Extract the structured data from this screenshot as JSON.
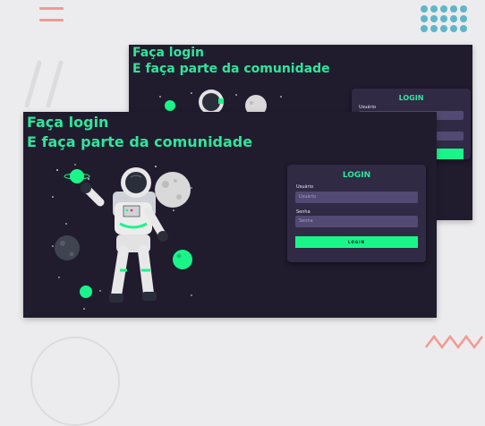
{
  "front_screen": {
    "heading_line1": "Faça login",
    "heading_line2": "E faça parte da comunidade",
    "login_card": {
      "title": "LOGIN",
      "username_label": "Usuário",
      "username_placeholder": "Usuário",
      "password_label": "Senha",
      "password_placeholder": "Senha",
      "button_label": "LOGIN"
    }
  },
  "back_screen": {
    "heading_line1": "Faça login",
    "heading_line2": "E faça parte da comunidade",
    "login_card": {
      "title": "LOGIN",
      "username_label": "Usuário",
      "username_placeholder": "",
      "password_label": "",
      "password_placeholder": "",
      "button_label": ""
    }
  },
  "icons": [
    "menu-icon",
    "dots-grid-icon",
    "astronaut-illustration",
    "planet-icon",
    "moon-icon"
  ],
  "colors": {
    "accent": "#30e59c",
    "button": "#1af58a",
    "screen_background": "#201c2e",
    "card_background": "#302a45",
    "input_background": "#534a73",
    "page_background": "#ececee"
  }
}
